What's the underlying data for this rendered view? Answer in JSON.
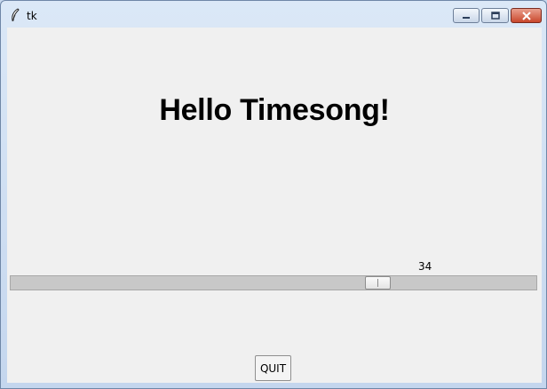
{
  "window": {
    "title": "tk",
    "app_icon": "feather-icon",
    "controls": [
      "minimize-icon",
      "maximize-icon",
      "close-icon"
    ]
  },
  "main": {
    "heading": "Hello Timesong!",
    "scale": {
      "value": 34,
      "value_label": "34",
      "range": [
        0,
        48
      ],
      "fraction": 0.70833
    },
    "quit_label": "QUIT"
  },
  "colors": {
    "close_button": "#c9472c",
    "client_bg": "#f0f0f0"
  }
}
